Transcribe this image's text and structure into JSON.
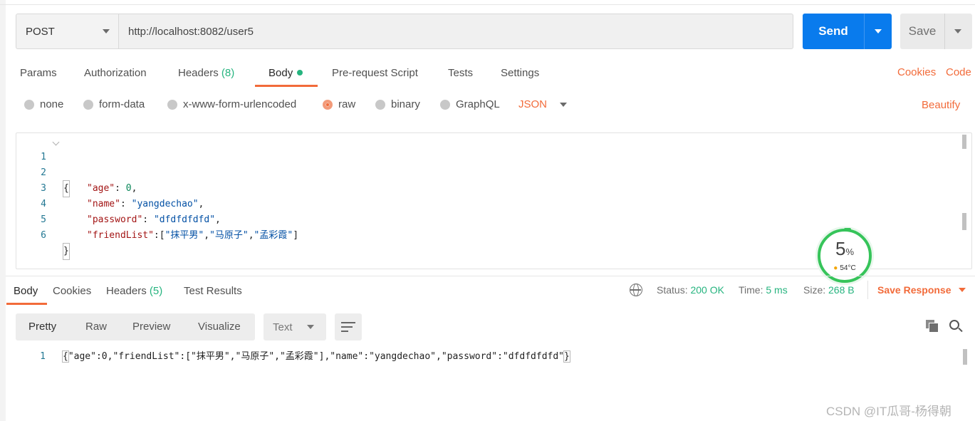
{
  "request": {
    "method": "POST",
    "url": "http://localhost:8082/user5",
    "send_label": "Send",
    "save_label": "Save"
  },
  "request_tabs": [
    {
      "label": "Params"
    },
    {
      "label": "Authorization"
    },
    {
      "label": "Headers",
      "count": "(8)"
    },
    {
      "label": "Body"
    },
    {
      "label": "Pre-request Script"
    },
    {
      "label": "Tests"
    },
    {
      "label": "Settings"
    }
  ],
  "request_links": {
    "cookies": "Cookies",
    "code": "Code",
    "beautify": "Beautify"
  },
  "body_types": [
    {
      "label": "none",
      "selected": false
    },
    {
      "label": "form-data",
      "selected": false
    },
    {
      "label": "x-www-form-urlencoded",
      "selected": false
    },
    {
      "label": "raw",
      "selected": true
    },
    {
      "label": "binary",
      "selected": false
    },
    {
      "label": "GraphQL",
      "selected": false
    }
  ],
  "raw_format": "JSON",
  "request_body": {
    "line_numbers": [
      "1",
      "2",
      "3",
      "4",
      "5",
      "6"
    ],
    "open_brace": "{",
    "close_brace": "}",
    "age_key": "\"age\"",
    "age_value": "0",
    "name_key": "\"name\"",
    "name_value": "\"yangdechao\"",
    "password_key": "\"password\"",
    "password_value": "\"dfdfdfdfd\"",
    "friendlist_key": "\"friendList\"",
    "friend_1": "\"抹平男\"",
    "friend_2": "\"马原子\"",
    "friend_3": "\"孟彩霞\""
  },
  "cpu_widget": {
    "percent": "5",
    "unit": "%",
    "temperature": "54°C"
  },
  "response_tabs": [
    {
      "label": "Body"
    },
    {
      "label": "Cookies"
    },
    {
      "label": "Headers",
      "count": "(5)"
    },
    {
      "label": "Test Results"
    }
  ],
  "response_meta": {
    "status_label": "Status:",
    "status_value": "200 OK",
    "time_label": "Time:",
    "time_value": "5 ms",
    "size_label": "Size:",
    "size_value": "268 B",
    "save_response_label": "Save Response"
  },
  "view_modes": [
    "Pretty",
    "Raw",
    "Preview",
    "Visualize"
  ],
  "response_format": "Text",
  "response_body": {
    "line_number": "1",
    "open_brace": "{",
    "content": "\"age\":0,\"friendList\":[\"抹平男\",\"马原子\",\"孟彩霞\"],\"name\":\"yangdechao\",\"password\":\"dfdfdfdfd\"",
    "close_brace": "}"
  },
  "watermark": "CSDN @IT瓜哥-杨得朝",
  "colors": {
    "accent": "#f26b3a",
    "send_blue": "#097bed",
    "success_green": "#26b47f"
  },
  "icons": [
    "globe-icon",
    "copy-icon",
    "search-icon",
    "wrap-lines-icon",
    "thermometer-icon"
  ]
}
